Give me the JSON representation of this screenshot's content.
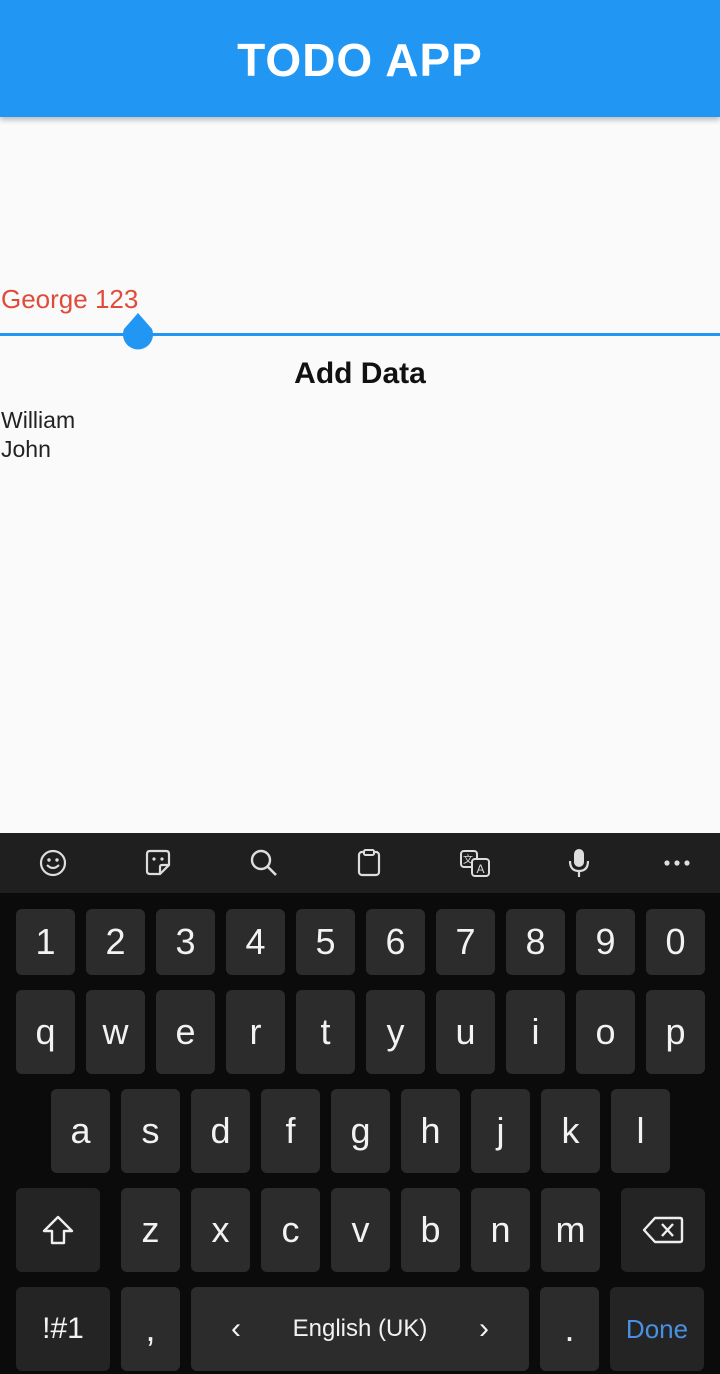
{
  "appbar": {
    "title": "TODO APP"
  },
  "input": {
    "value": "George 123"
  },
  "add_button": {
    "label": "Add Data"
  },
  "list": {
    "items": [
      "William",
      "John"
    ]
  },
  "keyboard": {
    "toolbar_icons": [
      "emoji-icon",
      "sticker-icon",
      "search-icon",
      "clipboard-icon",
      "translate-icon",
      "microphone-icon",
      "more-icon"
    ],
    "row_numbers": [
      "1",
      "2",
      "3",
      "4",
      "5",
      "6",
      "7",
      "8",
      "9",
      "0"
    ],
    "row_1": [
      "q",
      "w",
      "e",
      "r",
      "t",
      "y",
      "u",
      "i",
      "o",
      "p"
    ],
    "row_2": [
      "a",
      "s",
      "d",
      "f",
      "g",
      "h",
      "j",
      "k",
      "l"
    ],
    "row_3": [
      "z",
      "x",
      "c",
      "v",
      "b",
      "n",
      "m"
    ],
    "symbols_label": "!#1",
    "comma_label": ",",
    "space": {
      "language": "English (UK)",
      "left": "‹",
      "right": "›"
    },
    "period_label": ".",
    "done_label": "Done"
  },
  "colors": {
    "primary": "#2196f3",
    "input_text": "#e04b3a",
    "done_text": "#4a90e2",
    "keyboard_bg": "#0b0b0b",
    "key_bg": "#2c2c2c"
  }
}
